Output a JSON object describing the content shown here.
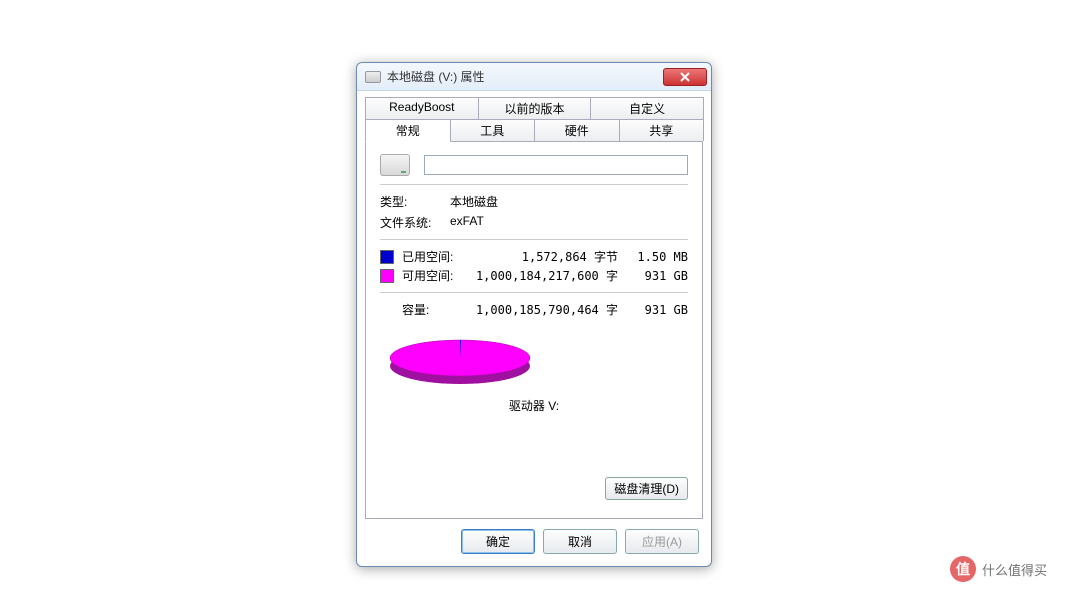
{
  "watermark": {
    "badge": "值",
    "text": "什么值得买"
  },
  "title": "本地磁盘 (V:) 属性",
  "tabs_row1": [
    "ReadyBoost",
    "以前的版本",
    "自定义"
  ],
  "tabs_row2": [
    "常规",
    "工具",
    "硬件",
    "共享"
  ],
  "active_tab": "常规",
  "drive_name": "",
  "type_label": "类型:",
  "type_value": "本地磁盘",
  "fs_label": "文件系统:",
  "fs_value": "exFAT",
  "used": {
    "label": "已用空间:",
    "bytes": "1,572,864 字节",
    "hr": "1.50 MB"
  },
  "free": {
    "label": "可用空间:",
    "bytes": "1,000,184,217,600 字",
    "hr": "931 GB"
  },
  "capacity": {
    "label": "容量:",
    "bytes": "1,000,185,790,464 字",
    "hr": "931 GB"
  },
  "drive_label": "驱动器 V:",
  "cleanup": "磁盘清理(D)",
  "buttons": {
    "ok": "确定",
    "cancel": "取消",
    "apply": "应用(A)"
  },
  "chart_data": {
    "type": "pie",
    "title": "驱动器 V:",
    "series": [
      {
        "name": "已用空间",
        "value": 1572864,
        "color": "#0000cd"
      },
      {
        "name": "可用空间",
        "value": 1000184217600,
        "color": "#ff00ff"
      }
    ],
    "total": 1000185790464
  }
}
